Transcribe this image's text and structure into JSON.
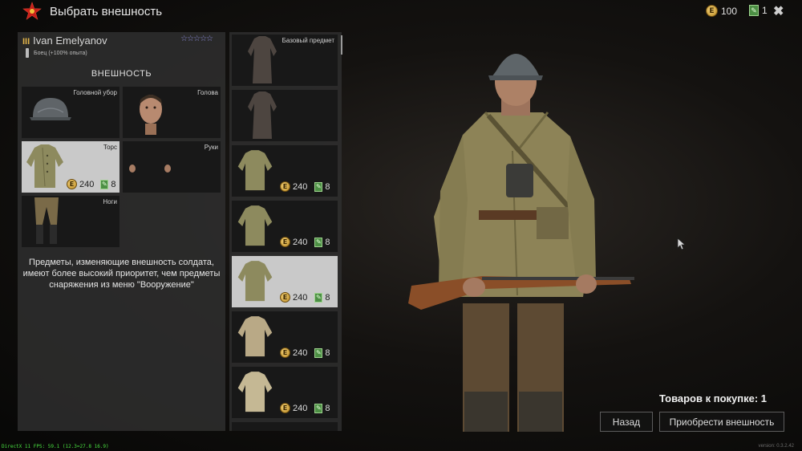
{
  "header": {
    "title": "Выбрать внешность",
    "coins": "100",
    "scrolls": "1"
  },
  "soldier": {
    "name": "Ivan Emelyanov",
    "rank": "III",
    "role": "Боец  (+100% опыта)"
  },
  "appearance": {
    "section_title": "ВНЕШНОСТЬ",
    "slots": [
      {
        "label": "Головной убор"
      },
      {
        "label": "Голова"
      },
      {
        "label": "Торс",
        "price_coins": "240",
        "price_scrolls": "8"
      },
      {
        "label": "Руки"
      },
      {
        "label": "Ноги"
      }
    ],
    "info": "Предметы, изменяющие внешность солдата, имеют более высокий приоритет, чем предметы снаряжения из меню \"Вооружение\""
  },
  "items": [
    {
      "label": "Базовый предмет"
    },
    {
      "label": ""
    },
    {
      "price_coins": "240",
      "price_scrolls": "8"
    },
    {
      "price_coins": "240",
      "price_scrolls": "8"
    },
    {
      "price_coins": "240",
      "price_scrolls": "8"
    },
    {
      "price_coins": "240",
      "price_scrolls": "8"
    },
    {
      "price_coins": "240",
      "price_scrolls": "8"
    }
  ],
  "footer": {
    "to_buy": "Товаров к покупке: 1",
    "back_label": "Назад",
    "buy_label": "Приобрести внешность",
    "debug": "DirectX 11 FPS: 59.1 (12.3=27.8 16.9)",
    "version": "version: 0.3.2.42"
  },
  "icons": {
    "coin": "E",
    "scroll": "✎"
  },
  "colors": {
    "accent_red": "#c8201a",
    "star": "#f2c23a",
    "gold": "#d9a63a",
    "scroll_green": "#4c8f44",
    "selected_bg": "#c9c9c9"
  }
}
